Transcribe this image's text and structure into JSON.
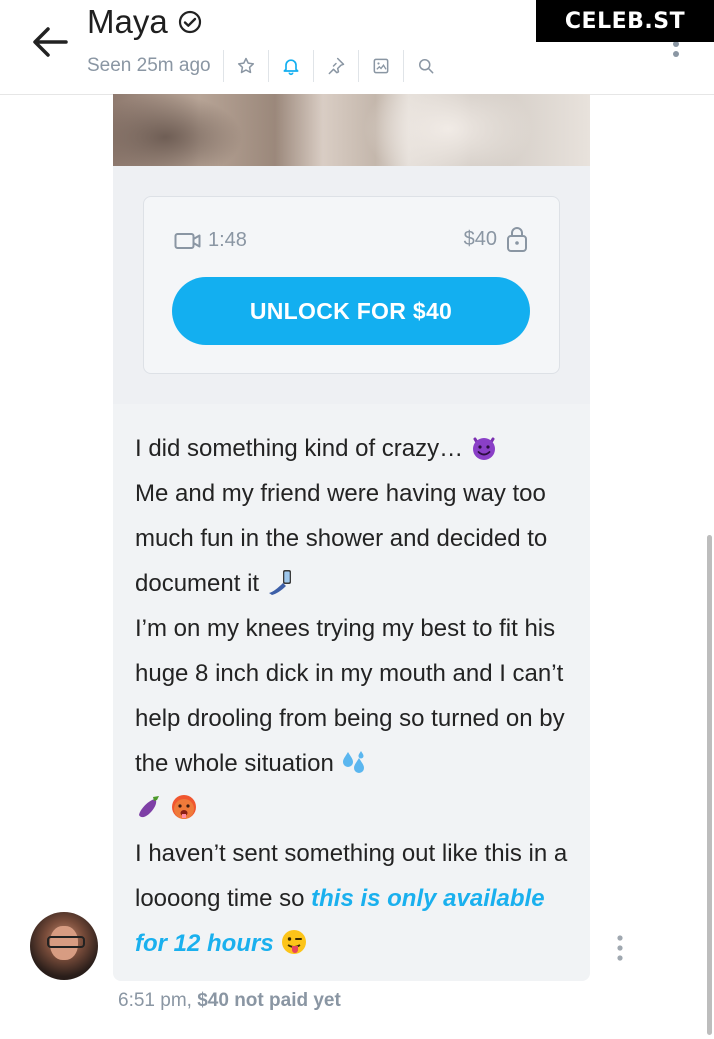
{
  "header": {
    "name": "Maya",
    "seen": "Seen 25m ago",
    "icons": [
      "star-icon",
      "bell-icon",
      "pin-icon",
      "image-icon",
      "search-icon"
    ]
  },
  "brand": "CELEB.ST",
  "locked_media": {
    "duration": "1:48",
    "price": "$40",
    "unlock_label": "UNLOCK FOR $40"
  },
  "message": {
    "line1": "I did something kind of crazy…",
    "line2": "Me and my friend were having way too much fun in the shower and decided to document it",
    "line3": "I’m on my knees trying my best to fit his huge 8 inch dick in my mouth and I can’t help drooling from being so turned on by the whole situation",
    "line4_prefix": "I haven’t sent something out like this in a loooong time so",
    "line4_link": "this is only available for 12 hours"
  },
  "meta": {
    "time": "6:51 pm,",
    "status": "$40 not paid yet"
  },
  "colors": {
    "accent": "#13aff0",
    "bubble": "#f1f3f5",
    "muted": "#8a96a3"
  }
}
